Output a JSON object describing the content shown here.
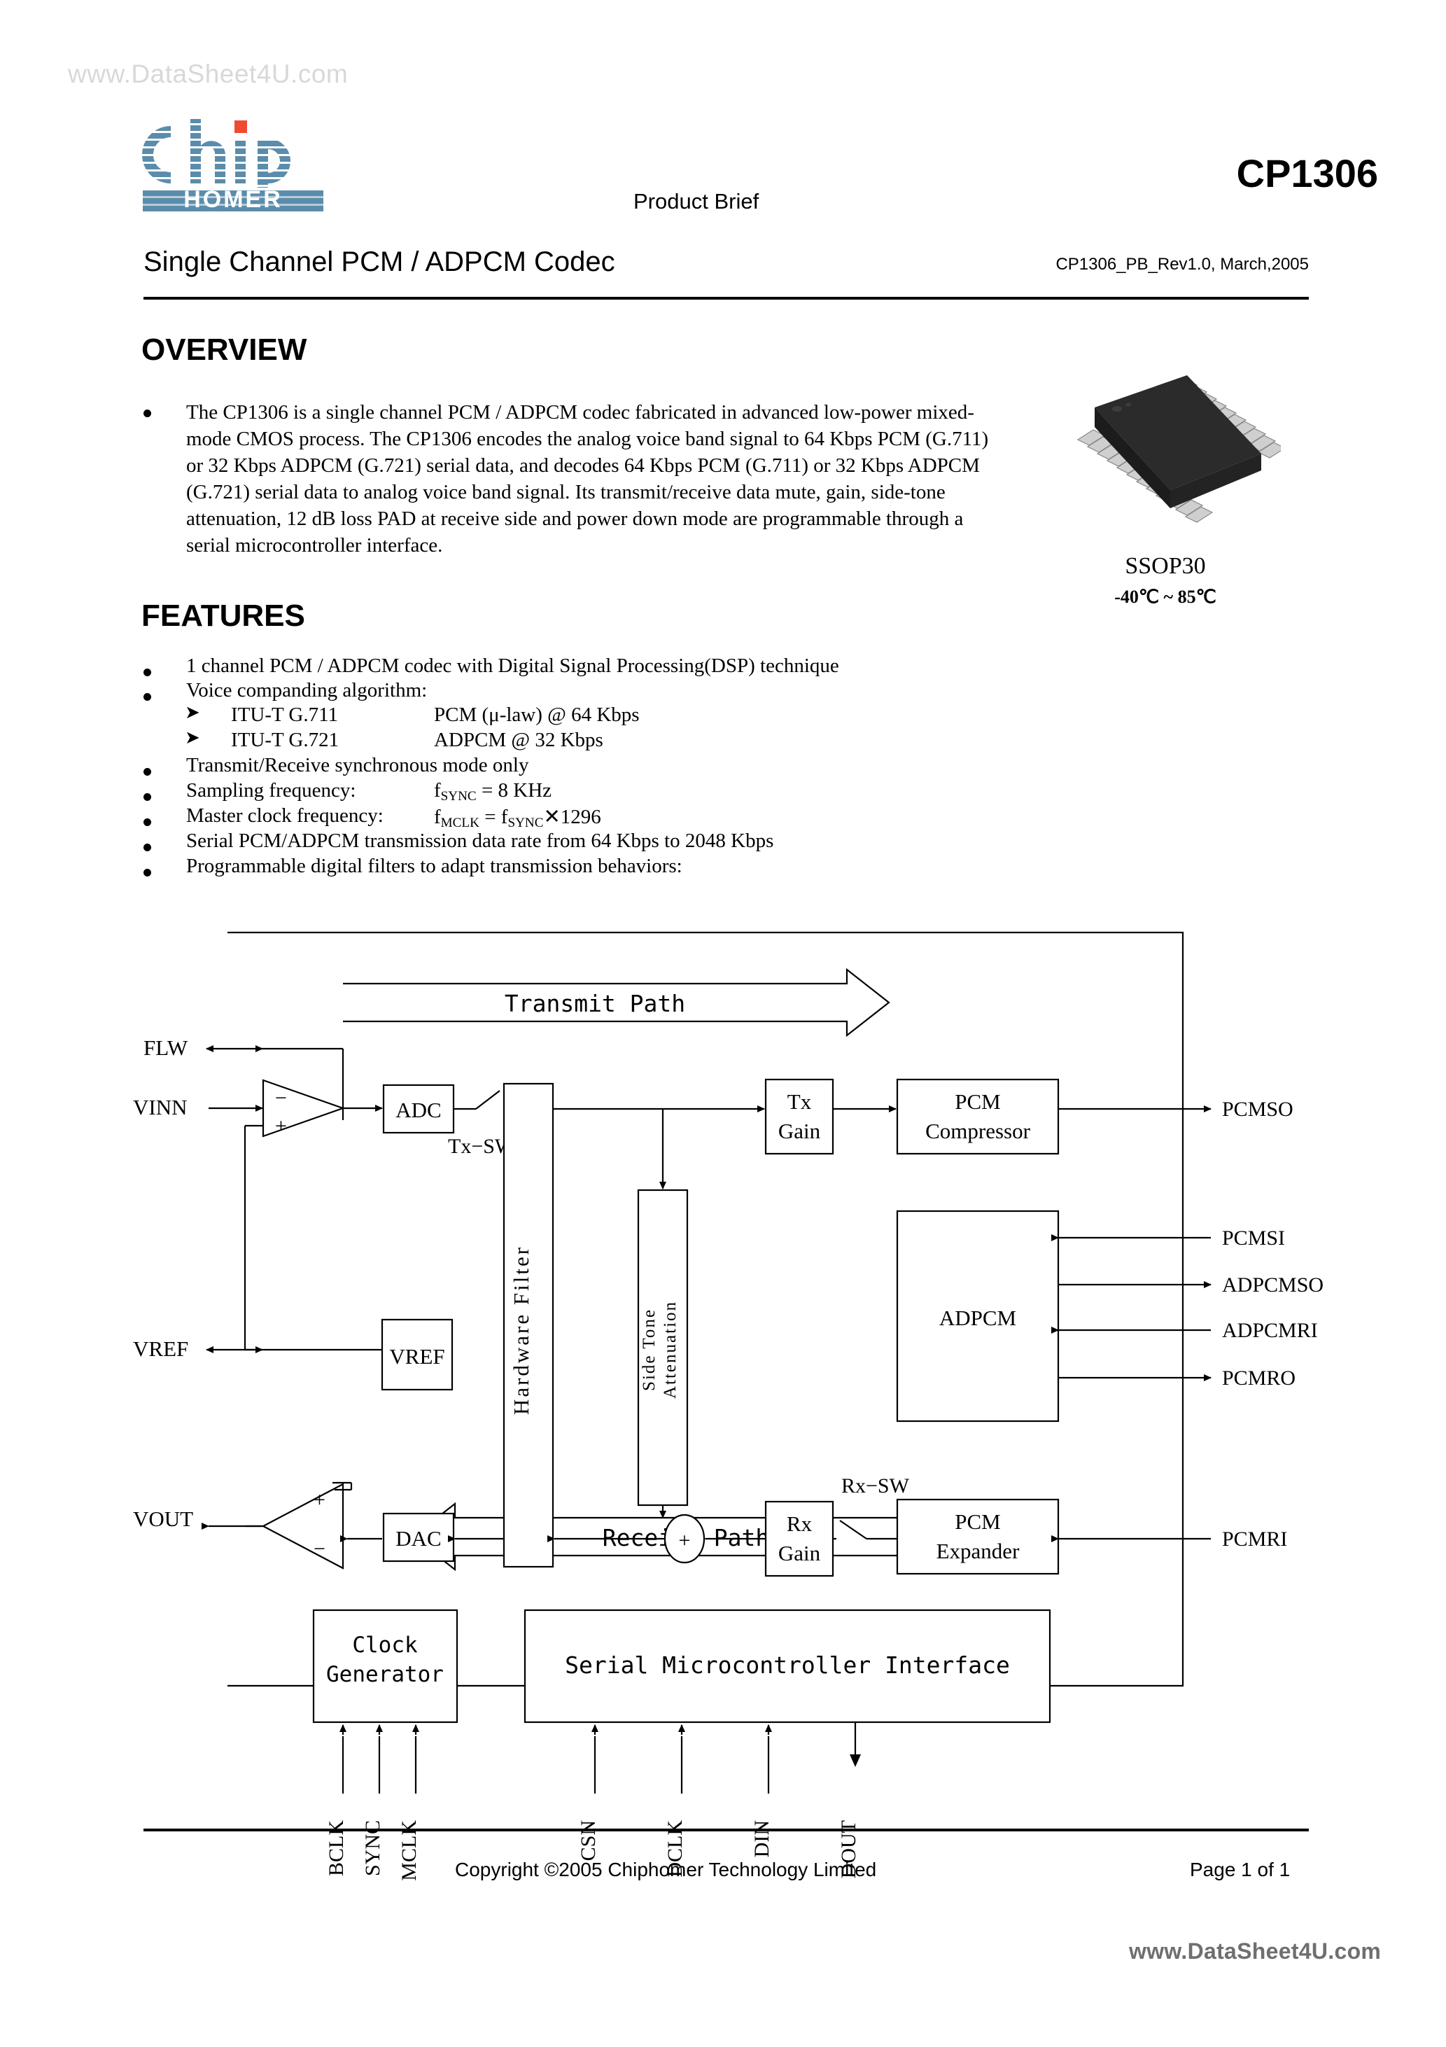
{
  "watermark": {
    "top": "www.DataSheet4U.com",
    "bottom": "www.DataSheet4U.com"
  },
  "header": {
    "logo_main": "Chip",
    "logo_sub": "HOMER",
    "product_brief": "Product Brief",
    "part_number": "CP1306",
    "doc_title": "Single Channel PCM / ADPCM Codec",
    "doc_revision": "CP1306_PB_Rev1.0, March,2005"
  },
  "overview": {
    "heading": "OVERVIEW",
    "paragraph": "The CP1306 is a single channel PCM / ADPCM codec fabricated in advanced low-power mixed-mode CMOS process. The CP1306 encodes the analog voice band signal to 64 Kbps PCM (G.711) or 32 Kbps ADPCM (G.721) serial data, and decodes 64 Kbps PCM (G.711) or 32 Kbps ADPCM (G.721) serial data to analog voice band signal. Its transmit/receive data mute, gain, side-tone attenuation, 12 dB loss PAD at receive side and power down mode are programmable through a serial microcontroller interface."
  },
  "package": {
    "name": "SSOP30",
    "temperature_range": "-40℃  ~ 85℃"
  },
  "features": {
    "heading": "FEATURES",
    "items": [
      {
        "type": "bullet",
        "text": "1 channel PCM / ADPCM codec with Digital Signal Processing(DSP) technique"
      },
      {
        "type": "bullet",
        "text": "Voice companding algorithm:"
      },
      {
        "type": "sub",
        "text": "ITU-T G.711",
        "value": "PCM (μ-law) @ 64 Kbps"
      },
      {
        "type": "sub",
        "text": "ITU-T G.721",
        "value": "ADPCM @ 32 Kbps"
      },
      {
        "type": "bullet",
        "text": "Transmit/Receive synchronous mode only"
      },
      {
        "type": "bullet",
        "text": "Sampling frequency:",
        "value_html": "f<sub>SYNC</sub> = 8 KHz"
      },
      {
        "type": "bullet",
        "text": "Master clock frequency:",
        "value_html": "f<sub>MCLK</sub> = f<sub>SYNC</sub> × 1296"
      },
      {
        "type": "bullet",
        "text": "Serial PCM/ADPCM transmission data rate from 64 Kbps to 2048 Kbps"
      },
      {
        "type": "bullet",
        "text": "Programmable digital filters to adapt transmission behaviors:"
      }
    ]
  },
  "block_diagram": {
    "path_labels": {
      "transmit": "Transmit Path",
      "receive": "Receive Path"
    },
    "switch_labels": {
      "tx": "Tx−SW",
      "rx": "Rx−SW"
    },
    "left_pins": [
      "FLW",
      "VINN",
      "VREF",
      "VOUT"
    ],
    "right_pins": [
      "PCMSO",
      "PCMSI",
      "ADPCMSO",
      "ADPCMRI",
      "PCMRO",
      "PCMRI"
    ],
    "bottom_pins": [
      "BCLK",
      "SYNC",
      "MCLK",
      "CSN",
      "DCLK",
      "DIN",
      "DOUT"
    ],
    "blocks": [
      {
        "id": "adc",
        "label": "ADC"
      },
      {
        "id": "vref",
        "label": "VREF"
      },
      {
        "id": "dac",
        "label": "DAC"
      },
      {
        "id": "hardware-filter",
        "label": "Hardware Filter"
      },
      {
        "id": "side-tone",
        "label_line1": "Side Tone",
        "label_line2": "Attenuation"
      },
      {
        "id": "tx-gain",
        "label_line1": "Tx",
        "label_line2": "Gain"
      },
      {
        "id": "rx-gain",
        "label_line1": "Rx",
        "label_line2": "Gain"
      },
      {
        "id": "pcm-compressor",
        "label_line1": "PCM",
        "label_line2": "Compressor"
      },
      {
        "id": "pcm-expander",
        "label_line1": "PCM",
        "label_line2": "Expander"
      },
      {
        "id": "adpcm",
        "label": "ADPCM"
      },
      {
        "id": "clock-generator",
        "label_line1": "Clock",
        "label_line2": "Generator"
      },
      {
        "id": "serial-mcu",
        "label": "Serial Microcontroller Interface"
      }
    ],
    "amp_signs": {
      "minus": "−",
      "plus": "+"
    },
    "summer_sign": "+"
  },
  "footer": {
    "copyright": "Copyright ©2005 Chiphomer Technology Limited",
    "page": "Page 1 of 1"
  },
  "colors": {
    "logo_blue": "#5b8cab",
    "logo_red": "#f04a32",
    "text": "#000000",
    "watermark_top": "#d8d8d8",
    "watermark_bottom": "#6f6f6f"
  }
}
